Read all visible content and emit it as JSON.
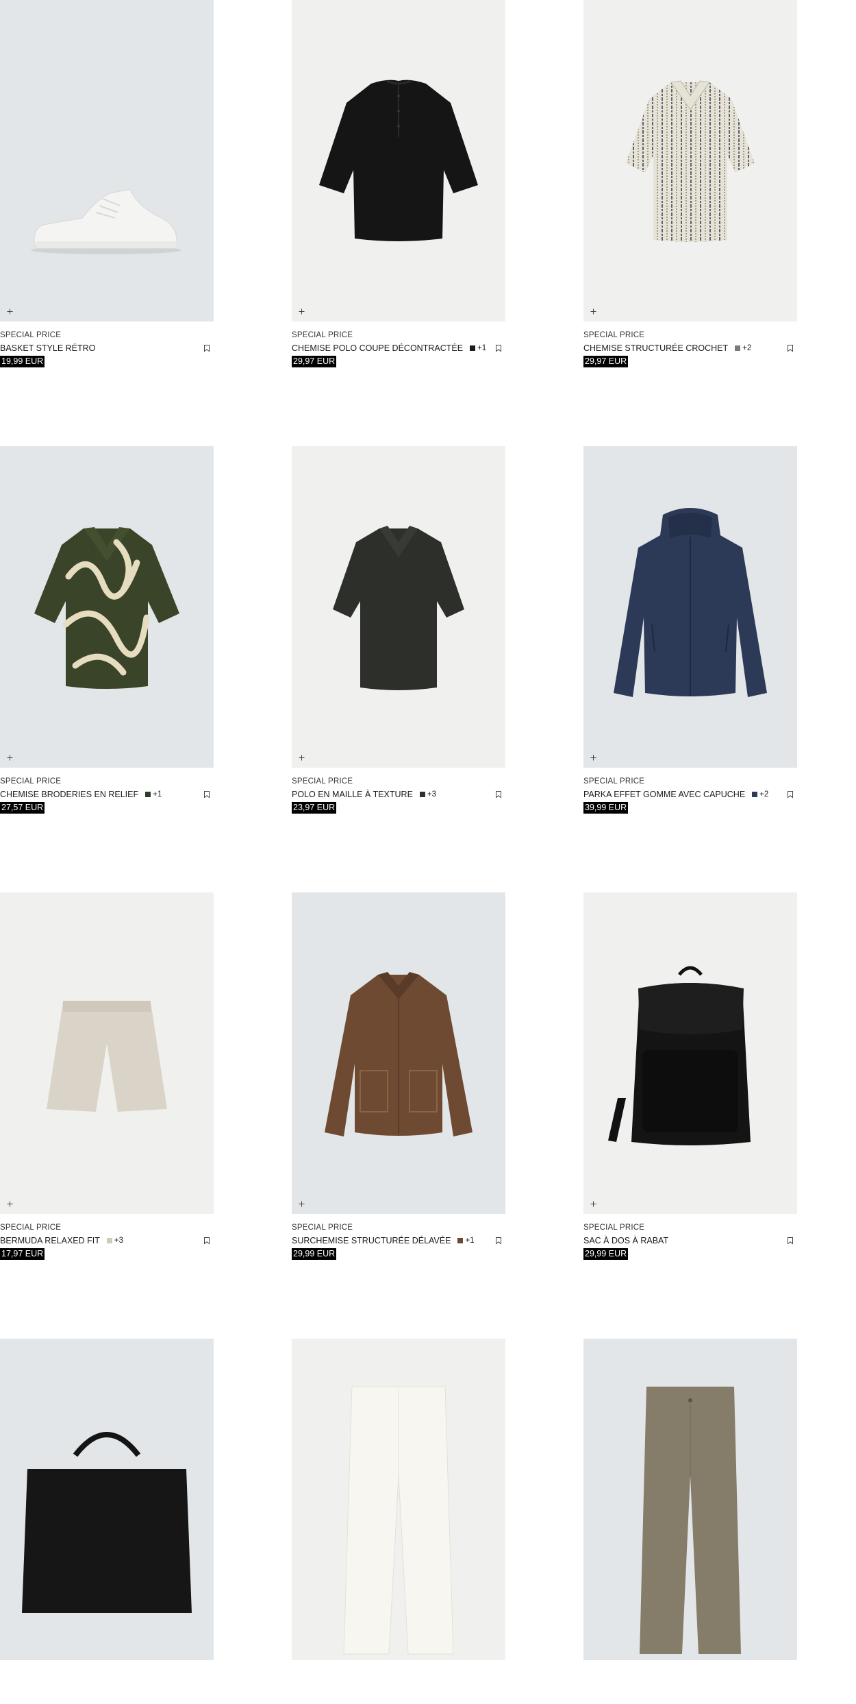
{
  "products": [
    {
      "tag": "SPECIAL PRICE",
      "name": "BASKET STYLE RÉTRO",
      "price": "19,99 EUR",
      "bg": "#e3e6e8",
      "image": "sneaker-image"
    },
    {
      "tag": "SPECIAL PRICE",
      "name": "CHEMISE POLO COUPE DÉCONTRACTÉE",
      "swatch_color": "#1c1c1c",
      "swatch_more": "+1",
      "price": "29,97 EUR",
      "bg": "#f0f0ef",
      "image": "black-polo-shirt-image"
    },
    {
      "tag": "SPECIAL PRICE",
      "name": "CHEMISE STRUCTURÉE CROCHET",
      "swatch_color": "#7a7a7a",
      "swatch_more": "+2",
      "price": "29,97 EUR",
      "bg": "#f0f0ef",
      "image": "crochet-shirt-image"
    },
    {
      "tag": "SPECIAL PRICE",
      "name": "CHEMISE BRODERIES EN RELIEF",
      "swatch_color": "#2e3a2a",
      "swatch_more": "+1",
      "price": "27,57 EUR",
      "bg": "#e3e6e8",
      "image": "embroidered-shirt-image"
    },
    {
      "tag": "SPECIAL PRICE",
      "name": "POLO EN MAILLE À TEXTURE",
      "swatch_color": "#2f322c",
      "swatch_more": "+3",
      "price": "23,97 EUR",
      "bg": "#f0f0ef",
      "image": "knit-polo-image"
    },
    {
      "tag": "SPECIAL PRICE",
      "name": "PARKA EFFET GOMME AVEC CAPUCHE",
      "swatch_color": "#2c3a55",
      "swatch_more": "+2",
      "price": "39,99 EUR",
      "bg": "#e3e6e8",
      "image": "parka-image"
    },
    {
      "tag": "SPECIAL PRICE",
      "name": "BERMUDA RELAXED FIT",
      "swatch_color": "#cfcabd",
      "swatch_more": "+3",
      "price": "17,97 EUR",
      "bg": "#f0f0ef",
      "image": "bermuda-shorts-image"
    },
    {
      "tag": "SPECIAL PRICE",
      "name": "SURCHEMISE STRUCTURÉE DÉLAVÉE",
      "swatch_color": "#6b4a34",
      "swatch_more": "+1",
      "price": "29,99 EUR",
      "bg": "#e3e6e8",
      "image": "overshirt-image"
    },
    {
      "tag": "SPECIAL PRICE",
      "name": "SAC À DOS À RABAT",
      "price": "29,99 EUR",
      "bg": "#f0f0ef",
      "image": "backpack-image"
    },
    {
      "tag": "",
      "name": "",
      "price": "",
      "bg": "#e3e6e8",
      "image": "bag-image"
    },
    {
      "tag": "",
      "name": "",
      "price": "",
      "bg": "#f0f0ef",
      "image": "white-trousers-image"
    },
    {
      "tag": "",
      "name": "",
      "price": "",
      "bg": "#e3e6e8",
      "image": "khaki-trousers-image"
    }
  ],
  "icons": {
    "quick_add": "plus-icon",
    "save": "bookmark-icon"
  }
}
